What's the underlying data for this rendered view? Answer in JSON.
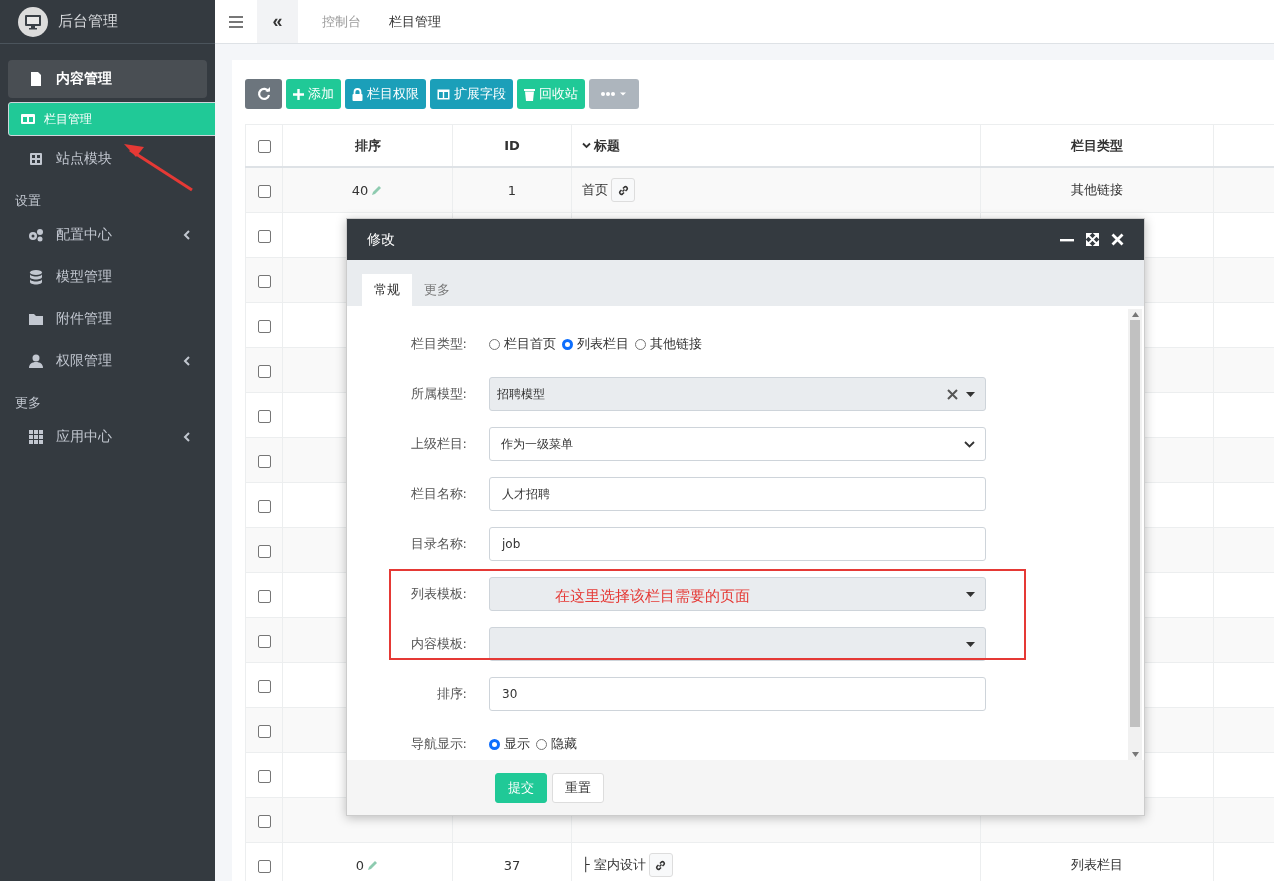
{
  "sidebar": {
    "brand": "后台管理",
    "sections": [
      {
        "items": [
          {
            "label": "内容管理",
            "selected": false,
            "expanded": true,
            "expandable": false
          },
          {
            "label": "栏目管理",
            "selected": true,
            "expanded": false,
            "expandable": false
          },
          {
            "label": "站点模块",
            "selected": false,
            "expanded": false,
            "expandable": false
          }
        ]
      },
      {
        "title": "设置",
        "items": [
          {
            "label": "配置中心",
            "selected": false,
            "expanded": false,
            "expandable": true
          },
          {
            "label": "模型管理",
            "selected": false,
            "expanded": false,
            "expandable": false
          },
          {
            "label": "附件管理",
            "selected": false,
            "expanded": false,
            "expandable": false
          },
          {
            "label": "权限管理",
            "selected": false,
            "expanded": false,
            "expandable": true
          }
        ]
      },
      {
        "title": "更多",
        "items": [
          {
            "label": "应用中心",
            "selected": false,
            "expanded": false,
            "expandable": true
          }
        ]
      }
    ]
  },
  "header": {
    "back": "«",
    "tabs": [
      {
        "label": "控制台",
        "selected": false
      },
      {
        "label": "栏目管理",
        "selected": true
      }
    ]
  },
  "toolbar": [
    {
      "kind": "secondary"
    },
    {
      "kind": "success",
      "label": "添加"
    },
    {
      "kind": "info",
      "label": "栏目权限"
    },
    {
      "kind": "info",
      "label": "扩展字段"
    },
    {
      "kind": "success",
      "label": "回收站"
    },
    {
      "kind": "more"
    }
  ],
  "table": {
    "all_checked": false,
    "columns": [
      "排序",
      "ID",
      "标题",
      "栏目类型"
    ],
    "rows": [
      {
        "checked": false,
        "sort": "40",
        "id": "1",
        "title": "首页",
        "type": "其他链接"
      },
      {
        "checked": false
      },
      {
        "checked": false
      },
      {
        "checked": false
      },
      {
        "checked": false
      },
      {
        "checked": false
      },
      {
        "checked": false
      },
      {
        "checked": false
      },
      {
        "checked": false
      },
      {
        "checked": false
      },
      {
        "checked": false
      },
      {
        "checked": false
      },
      {
        "checked": false
      },
      {
        "checked": false
      },
      {
        "checked": false
      },
      {
        "checked": false,
        "sort": "0",
        "id": "37",
        "title": "├ 室内设计",
        "type": "列表栏目"
      }
    ]
  },
  "dialog": {
    "title": "修改",
    "tabs": [
      {
        "label": "常规",
        "selected": true
      },
      {
        "label": "更多",
        "selected": false
      }
    ],
    "fields": [
      {
        "kind": "radio",
        "label": "栏目类型:",
        "options": [
          {
            "label": "栏目首页",
            "selected": false
          },
          {
            "label": "列表栏目",
            "selected": true
          },
          {
            "label": "其他链接",
            "selected": false
          }
        ]
      },
      {
        "kind": "select2",
        "label": "所属模型:",
        "value": "招聘模型",
        "clearable": true
      },
      {
        "kind": "select",
        "label": "上级栏目:",
        "value": "作为一级菜单"
      },
      {
        "kind": "text",
        "label": "栏目名称:",
        "value": "人才招聘"
      },
      {
        "kind": "text",
        "label": "目录名称:",
        "value": "job"
      },
      {
        "kind": "select2",
        "label": "列表模板:",
        "clearable": false
      },
      {
        "kind": "select2",
        "label": "内容模板:",
        "clearable": false
      },
      {
        "kind": "text",
        "label": "排序:",
        "value": "30"
      },
      {
        "kind": "radio",
        "label": "导航显示:",
        "options": [
          {
            "label": "显示",
            "selected": true
          },
          {
            "label": "隐藏",
            "selected": false
          }
        ]
      }
    ],
    "buttons": [
      {
        "kind": "primary",
        "label": "提交"
      },
      {
        "kind": "default",
        "label": "重置"
      }
    ],
    "annotation": "在这里选择该栏目需要的页面"
  }
}
